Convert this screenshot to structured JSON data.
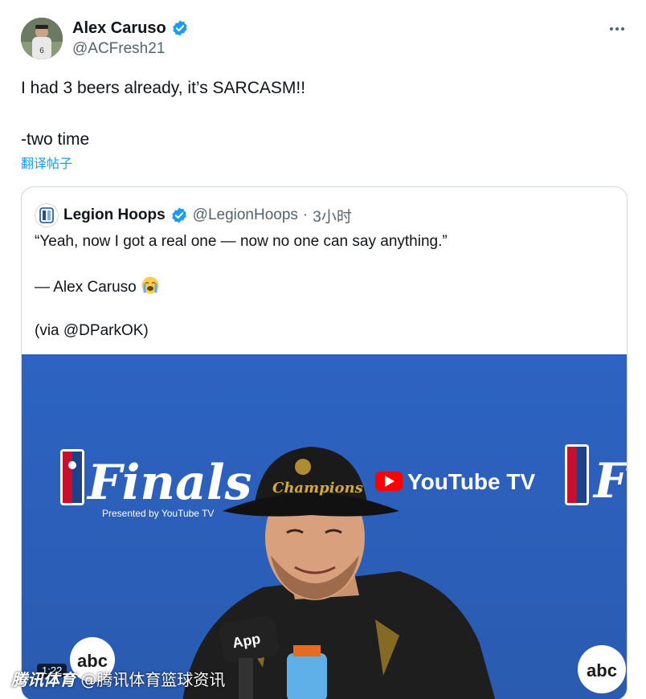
{
  "author": {
    "name": "Alex Caruso",
    "handle": "@ACFresh21",
    "verified": true,
    "avatar_icon": "player-avatar"
  },
  "tweet": {
    "line1": "I had 3 beers already, it’s SARCASM!!",
    "line2": "-two time",
    "translate_label": "翻译帖子"
  },
  "quoted": {
    "name": "Legion Hoops",
    "handle": "@LegionHoops",
    "separator": "·",
    "time": "3小时",
    "text_line1": "“Yeah, now I got a real one — now no one can say anything.”",
    "text_line2": "— Alex Caruso",
    "text_line2_emoji": "crying-face-emoji",
    "text_line3": "(via @DParkOK)"
  },
  "media": {
    "backdrop_brand_1": "Finals",
    "backdrop_brand_2": "Finals",
    "sponsor": "YouTube TV",
    "presented_by": "Presented by YouTube TV",
    "hat_text": "Champions",
    "mic_label": "App",
    "abc_label": "abc",
    "duration": "1:22"
  },
  "watermark": {
    "brand": "腾讯体育",
    "text": "@腾讯体育篮球资讯"
  },
  "colors": {
    "accent": "#1d9bf0",
    "secondary_text": "#536471",
    "backdrop_blue": "#2a5fb8"
  }
}
